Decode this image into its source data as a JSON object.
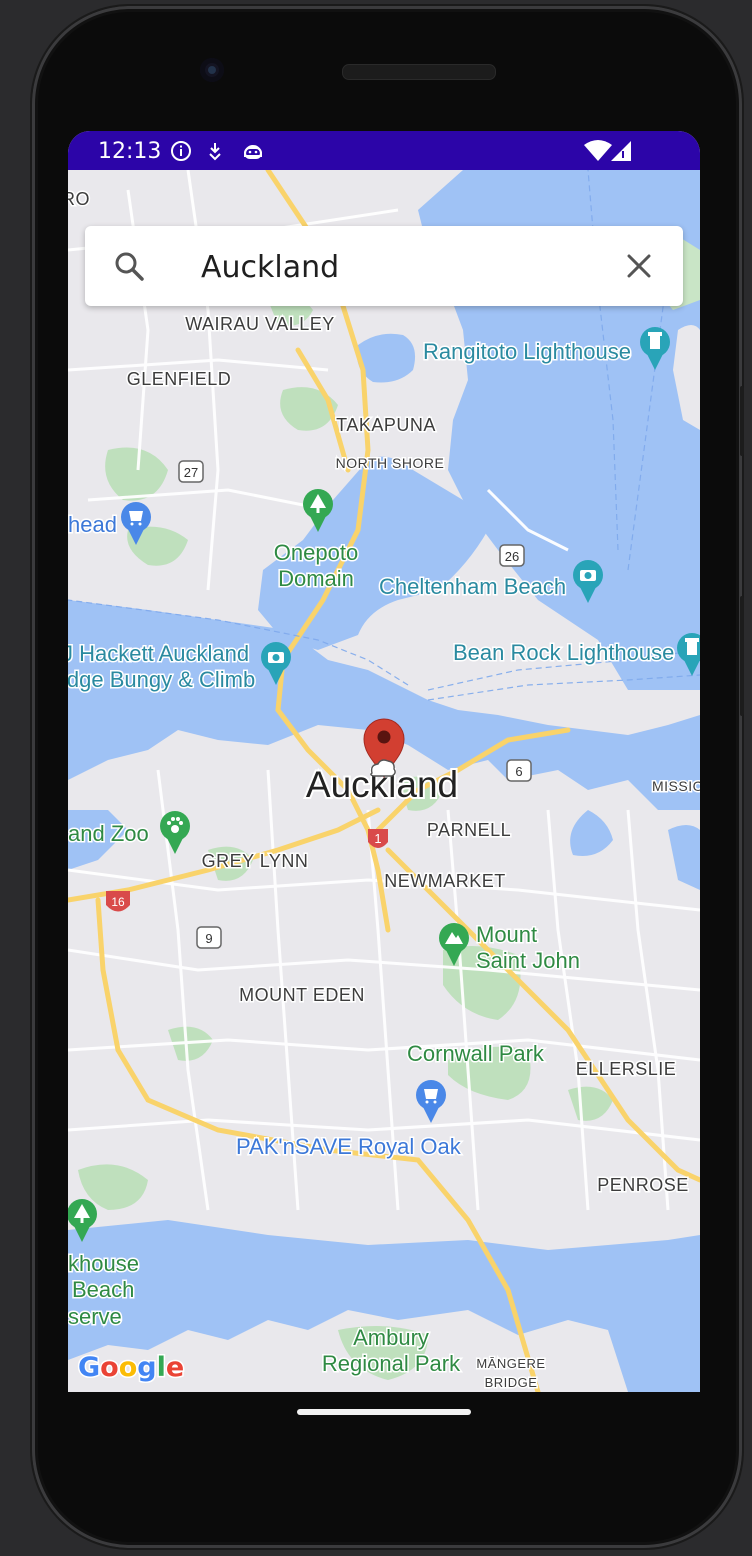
{
  "status_bar": {
    "time": "12:13",
    "icons": [
      "info-icon",
      "download-icon",
      "android-debug-icon",
      "wifi-icon",
      "cellular-icon"
    ]
  },
  "search": {
    "query": "Auckland",
    "icon": "search-icon",
    "clear_icon": "close-icon"
  },
  "map": {
    "selected_city": "Auckland",
    "districts": [
      "WAIRAU VALLEY",
      "GLENFIELD",
      "TAKAPUNA",
      "NORTH SHORE",
      "PARNELL",
      "GREY LYNN",
      "NEWMARKET",
      "MOUNT EDEN",
      "ELLERSLIE",
      "PENROSE",
      "MISSIO",
      "MĀNGERE",
      "BRIDGE",
      "RO"
    ],
    "places": {
      "rangitoto": "Rangitoto Lighthouse",
      "onepoto_1": "Onepoto",
      "onepoto_2": "Domain",
      "cheltenham": "Cheltenham Beach",
      "bean_rock": "Bean Rock Lighthouse",
      "hackett_1": "J Hackett Auckland",
      "hackett_2": "idge Bungy & Climb",
      "zoo": "and Zoo",
      "mount_st_john_1": "Mount",
      "mount_st_john_2": "Saint John",
      "cornwall": "Cornwall Park",
      "paknsave": "PAK'nSAVE Royal Oak",
      "head": "head",
      "khouse_1": "khouse",
      "khouse_2": "Beach",
      "khouse_3": "serve",
      "ambury_1": "Ambury",
      "ambury_2": "Regional Park"
    },
    "routes": [
      "27",
      "26",
      "6",
      "1",
      "16",
      "9"
    ],
    "attribution": "Google"
  },
  "colors": {
    "status_bar": "#2c05a8",
    "water": "#9fc2f5",
    "land": "#e9e8ec",
    "park": "#bfe0bd",
    "highway": "#f9d36b",
    "pin": "#d23f31",
    "poi_blue": "#4a88e8",
    "poi_teal": "#29a4b8",
    "poi_green": "#34a853"
  }
}
